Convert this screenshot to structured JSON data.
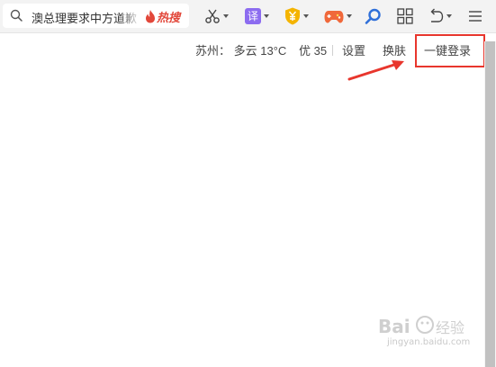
{
  "toolbar": {
    "search": {
      "text": "澳总理要求中方道歉",
      "hot_label": "热搜"
    },
    "tools": [
      {
        "name": "scissors-icon",
        "has_dropdown": true
      },
      {
        "name": "translate-icon",
        "label": "译",
        "has_dropdown": true
      },
      {
        "name": "shield-yen-icon",
        "has_dropdown": true
      },
      {
        "name": "gamepad-icon",
        "has_dropdown": true
      },
      {
        "name": "search-icon",
        "has_dropdown": false
      },
      {
        "name": "apps-grid-icon",
        "has_dropdown": false
      },
      {
        "name": "undo-icon",
        "has_dropdown": true
      },
      {
        "name": "menu-icon",
        "has_dropdown": false
      }
    ]
  },
  "infobar": {
    "weather": "苏州： 多云 13°C",
    "air_quality": "优 35",
    "settings": "设置",
    "skin": "换肤",
    "login": "一键登录"
  },
  "watermark": {
    "url": "jingyan.baidu.com"
  },
  "colors": {
    "toolbar_bg": "#f3f3f3",
    "highlight": "#e8362d",
    "hot": "#e2473a",
    "translate": "#8c6cf0",
    "shield": "#f4b400",
    "gamepad": "#f0683a",
    "search_icon": "#2f6fd9"
  }
}
